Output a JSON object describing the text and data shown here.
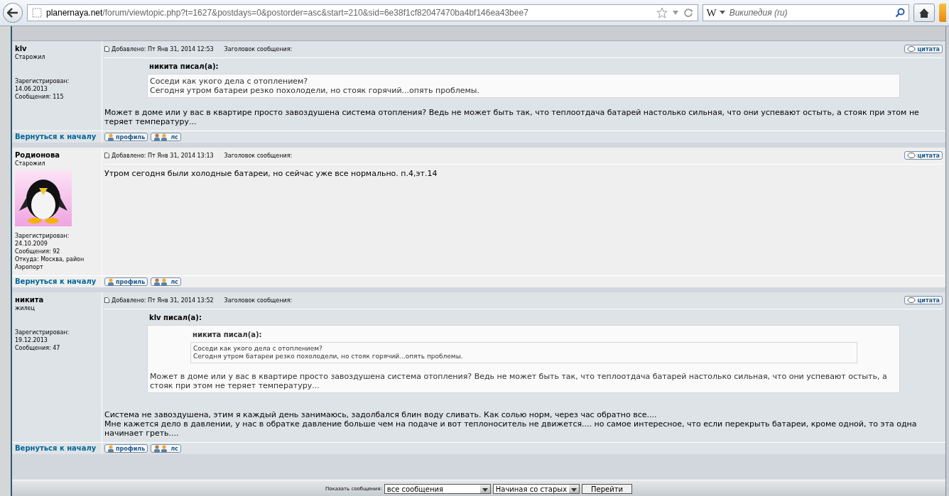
{
  "browser": {
    "url_host": "planernaya.net",
    "url_path": "/forum/viewtopic.php?t=1627&postdays=0&postorder=asc&start=210&sid=6e38f1cf82047470ba4bf146ea43bee7",
    "search_engine": "W",
    "search_placeholder": "Википедия (ru)"
  },
  "posts": [
    {
      "author": "klv",
      "rank": "Старожил",
      "profile": [
        "Зарегистрирован:",
        "14.06.2013",
        "Сообщения: 115"
      ],
      "posted": "Добавлено: Пт Янв 31, 2014 12:53",
      "subject_label": "Заголовок сообщения:",
      "quote_button": "цитата",
      "quote": {
        "title": "никита писал(а):",
        "lines": [
          "Соседи как укого дела с отоплением?",
          "Сегодня утром батареи резко похолодели, но стояк горячий...опять проблемы."
        ]
      },
      "body": [
        "Может в доме или у вас в квартире просто завоздушена система отопления? Ведь не может быть так, что теплоотдача батарей настолько сильная, что они успевают остыть, а стояк при этом не теряет температуру..."
      ],
      "back_link": "Вернуться к началу",
      "buttons": [
        {
          "kind": "profile",
          "label": "профиль"
        },
        {
          "kind": "pm",
          "label": "лс"
        }
      ]
    },
    {
      "author": "Родионова",
      "rank": "Старожил",
      "avatar": {
        "kind": "picture"
      },
      "profile": [
        "Зарегистрирован:",
        "24.10.2009",
        "Сообщения: 92",
        "Откуда: Москва, район Аэропорт"
      ],
      "posted": "Добавлено: Пт Янв 31, 2014 13:13",
      "subject_label": "Заголовок сообщения:",
      "quote_button": "цитата",
      "body": [
        "Утром сегодня были холодные батареи, но сейчас уже все нормально. п.4,эт.14"
      ],
      "back_link": "Вернуться к началу",
      "buttons": [
        {
          "kind": "profile",
          "label": "профиль"
        },
        {
          "kind": "pm",
          "label": "лс"
        }
      ]
    },
    {
      "author": "никита",
      "rank": "жилец",
      "profile": [
        "Зарегистрирован:",
        "19.12.2013",
        "Сообщения: 47"
      ],
      "posted": "Добавлено: Пт Янв 31, 2014 13:52",
      "subject_label": "Заголовок сообщения:",
      "quote_button": "цитата",
      "quote": {
        "title": "klv писал(а):",
        "quote": {
          "title": "никита писал(а):",
          "lines": [
            "Соседи как укого дела с отоплением?",
            "Сегодня утром батареи резко похолодели, но стояк горячий...опять проблемы."
          ]
        },
        "lines": [
          "Может в доме или у вас в квартире просто завоздушена система отопления? Ведь не может быть так, что теплоотдача батарей настолько сильная, что они успевают остыть, а стояк при этом не теряет температуру..."
        ]
      },
      "body": [
        "Система не завоздушена, этим я каждый день занимаюсь, задолбался блин воду сливать. Как солью норм, через час обратно все....",
        "Мне кажется дело в давлении, у нас в обратке давление больше чем на подаче и вот теплоноситель не движется.... но самое интересное, что если перекрыть батареи, кроме одной, то эта одна начинает греть...."
      ],
      "back_link": "Вернуться к началу",
      "buttons": [
        {
          "kind": "profile",
          "label": "профиль"
        },
        {
          "kind": "pm",
          "label": "лс"
        }
      ]
    }
  ],
  "footer": {
    "label": "Показать сообщения:",
    "select_days": "все сообщения",
    "select_order": "Начиная со старых",
    "button": "Перейти"
  }
}
